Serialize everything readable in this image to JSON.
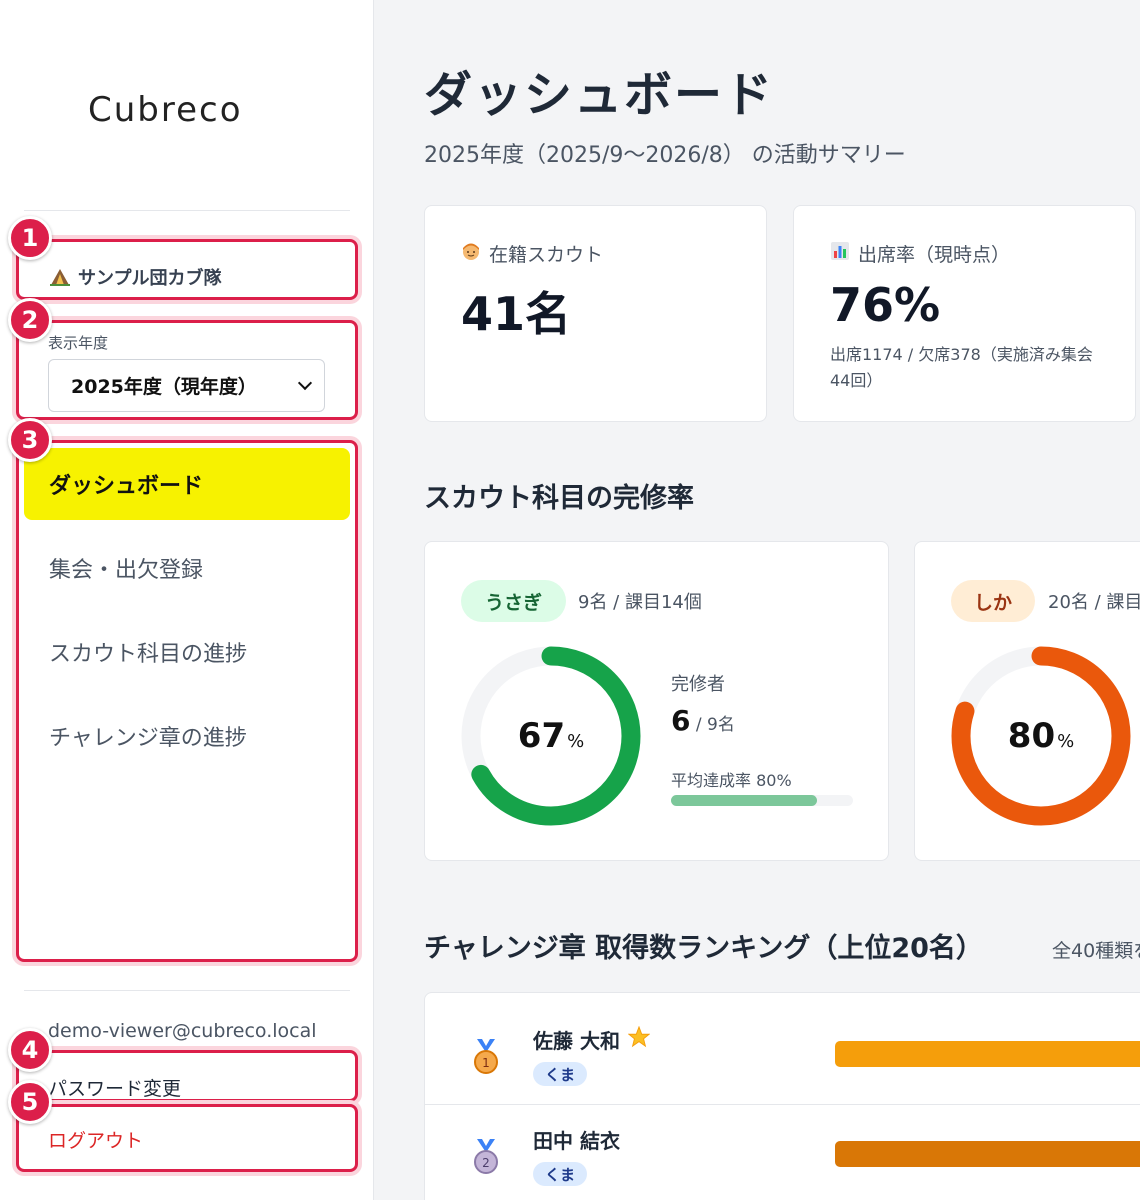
{
  "sidebar": {
    "logo": "Cubreco",
    "troop_name": "サンプル団カブ隊",
    "year_label": "表示年度",
    "year_selected": "2025年度（現年度）",
    "nav": [
      {
        "label": "ダッシュボード",
        "active": true
      },
      {
        "label": "集会・出欠登録",
        "active": false
      },
      {
        "label": "スカウト科目の進捗",
        "active": false
      },
      {
        "label": "チャレンジ章の進捗",
        "active": false
      }
    ],
    "user_email": "demo-viewer@cubreco.local",
    "password_link": "パスワード変更",
    "logout_link": "ログアウト"
  },
  "annotations": [
    "1",
    "2",
    "3",
    "4",
    "5"
  ],
  "main": {
    "title": "ダッシュボード",
    "subtitle": "2025年度（2025/9〜2026/8） の活動サマリー",
    "stats": [
      {
        "icon": "scout-face-icon",
        "label": "在籍スカウト",
        "value": "41名",
        "note": ""
      },
      {
        "icon": "bar-chart-icon",
        "label": "出席率（現時点）",
        "value": "76%",
        "note": "出席1174 / 欠席378（実施済み集会44回）"
      }
    ],
    "completion_title": "スカウト科目の完修率",
    "groups": [
      {
        "badge": "うさぎ",
        "meta": "9名 / 課目14個",
        "percent": 67,
        "percent_unit": "%",
        "finisher_label": "完修者",
        "finisher_count": "6",
        "finisher_total": " / 9名",
        "avg_label": "平均達成率 80%",
        "avg_value": 80,
        "color": "#16a34a",
        "badge_bg": "#dcfce7",
        "badge_fg": "#166534"
      },
      {
        "badge": "しか",
        "meta": "20名 / 課目",
        "percent": 80,
        "percent_unit": "%",
        "color": "#ea580c",
        "badge_bg": "#ffedd5",
        "badge_fg": "#9a3412"
      }
    ],
    "ranking_title": "チャレンジ章 取得数ランキング（上位20名）",
    "ranking_note": "全40種類を",
    "ranking": [
      {
        "rank": "1",
        "name": "佐藤 大和",
        "star": true,
        "tag": "くま",
        "bar_color": "#f59e0b"
      },
      {
        "rank": "2",
        "name": "田中 結衣",
        "star": false,
        "tag": "くま",
        "bar_color": "#d97706"
      }
    ]
  }
}
